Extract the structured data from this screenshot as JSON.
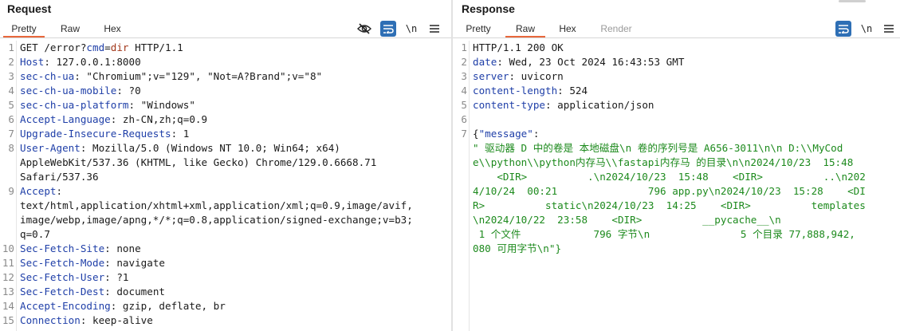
{
  "request": {
    "title": "Request",
    "tabs": [
      "Pretty",
      "Raw",
      "Hex"
    ],
    "active_tab": "Pretty",
    "toolbar": {
      "newline_label": "\\n"
    },
    "lines": [
      {
        "n": "1",
        "parts": [
          "GET /error?",
          "cmd",
          "=",
          "dir",
          " HTTP/1.1"
        ]
      },
      {
        "n": "2",
        "name": "Host",
        "value": " 127.0.0.1:8000"
      },
      {
        "n": "3",
        "name": "sec-ch-ua",
        "value": " \"Chromium\";v=\"129\", \"Not=A?Brand\";v=\"8\""
      },
      {
        "n": "4",
        "name": "sec-ch-ua-mobile",
        "value": " ?0"
      },
      {
        "n": "5",
        "name": "sec-ch-ua-platform",
        "value": " \"Windows\""
      },
      {
        "n": "6",
        "name": "Accept-Language",
        "value": " zh-CN,zh;q=0.9"
      },
      {
        "n": "7",
        "name": "Upgrade-Insecure-Requests",
        "value": " 1"
      },
      {
        "n": "8",
        "name": "User-Agent",
        "value": " Mozilla/5.0 (Windows NT 10.0; Win64; x64)"
      },
      {
        "n": "",
        "cont": "AppleWebKit/537.36 (KHTML, like Gecko) Chrome/129.0.6668.71"
      },
      {
        "n": "",
        "cont": "Safari/537.36"
      },
      {
        "n": "9",
        "name": "Accept",
        "value": ""
      },
      {
        "n": "",
        "cont": "text/html,application/xhtml+xml,application/xml;q=0.9,image/avif,"
      },
      {
        "n": "",
        "cont": "image/webp,image/apng,*/*;q=0.8,application/signed-exchange;v=b3;"
      },
      {
        "n": "",
        "cont": "q=0.7"
      },
      {
        "n": "10",
        "name": "Sec-Fetch-Site",
        "value": " none"
      },
      {
        "n": "11",
        "name": "Sec-Fetch-Mode",
        "value": " navigate"
      },
      {
        "n": "12",
        "name": "Sec-Fetch-User",
        "value": " ?1"
      },
      {
        "n": "13",
        "name": "Sec-Fetch-Dest",
        "value": " document"
      },
      {
        "n": "14",
        "name": "Accept-Encoding",
        "value": " gzip, deflate, br"
      },
      {
        "n": "15",
        "name": "Connection",
        "value": " keep-alive"
      }
    ]
  },
  "response": {
    "title": "Response",
    "tabs": [
      "Pretty",
      "Raw",
      "Hex",
      "Render"
    ],
    "active_tab": "Raw",
    "toolbar": {
      "newline_label": "\\n"
    },
    "lines": [
      {
        "n": "1",
        "status": "HTTP/1.1 200 OK"
      },
      {
        "n": "2",
        "name": "date",
        "value": " Wed, 23 Oct 2024 16:43:53 GMT"
      },
      {
        "n": "3",
        "name": "server",
        "value": " uvicorn"
      },
      {
        "n": "4",
        "name": "content-length",
        "value": " 524"
      },
      {
        "n": "5",
        "name": "content-type",
        "value": " application/json"
      },
      {
        "n": "6",
        "blank": true
      },
      {
        "n": "7",
        "json_open": "{",
        "json_key": "\"message\"",
        "json_colon": ":"
      },
      {
        "n": "",
        "json": "\" 驱动器 D 中的卷是 本地磁盘\\n 卷的序列号是 A656-3011\\n\\n D:\\\\MyCod"
      },
      {
        "n": "",
        "json": "e\\\\python\\\\python内存马\\\\fastapi内存马 的目录\\n\\n2024/10/23  15:48"
      },
      {
        "n": "",
        "json": "    <DIR>          .\\n2024/10/23  15:48    <DIR>          ..\\n202"
      },
      {
        "n": "",
        "json": "4/10/24  00:21               796 app.py\\n2024/10/23  15:28    <DI"
      },
      {
        "n": "",
        "json": "R>          static\\n2024/10/23  14:25    <DIR>          templates"
      },
      {
        "n": "",
        "json": "\\n2024/10/22  23:58    <DIR>          __pycache__\\n"
      },
      {
        "n": "",
        "json": " 1 个文件            796 字节\\n               5 个目录 77,888,942,"
      },
      {
        "n": "",
        "json": "080 可用字节\\n\"}"
      }
    ]
  },
  "colors": {
    "accent_tab": "#e8683c",
    "header_name": "#1f3fa8",
    "json_string": "#1d8a1d",
    "toolbar_blue": "#2e6fb5"
  },
  "icons": [
    "eye-off-icon",
    "wrap-icon",
    "newline-icon",
    "hamburger-menu-icon"
  ]
}
